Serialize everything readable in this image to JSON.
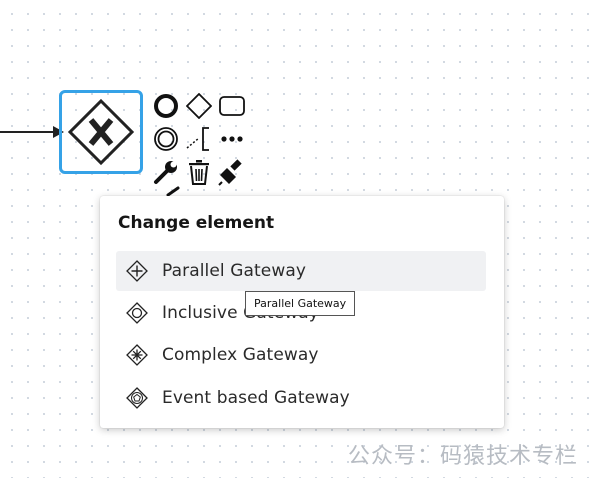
{
  "canvas": {
    "selected_element": "exclusive-gateway",
    "context_pad": {
      "tools": [
        {
          "name": "append-end-event-icon"
        },
        {
          "name": "append-gateway-icon"
        },
        {
          "name": "append-task-icon"
        },
        {
          "name": "append-intermediate-event-icon"
        },
        {
          "name": "append-text-annotation-icon"
        },
        {
          "name": "more-options-icon"
        },
        {
          "name": "change-type-wrench-icon"
        },
        {
          "name": "delete-trash-icon"
        },
        {
          "name": "color-paint-icon"
        }
      ]
    }
  },
  "popup": {
    "title": "Change element",
    "entries": [
      {
        "label": "Parallel Gateway",
        "icon": "parallel-gateway-icon",
        "hovered": true
      },
      {
        "label": "Inclusive Gateway",
        "icon": "inclusive-gateway-icon",
        "hovered": false
      },
      {
        "label": "Complex Gateway",
        "icon": "complex-gateway-icon",
        "hovered": false
      },
      {
        "label": "Event based Gateway",
        "icon": "event-based-gateway-icon",
        "hovered": false
      }
    ]
  },
  "tooltip": {
    "text": "Parallel Gateway"
  },
  "watermark": {
    "text": "公众号：码猿技术专栏"
  },
  "colors": {
    "selection": "#35a2e7",
    "hover_bg": "#f0f1f3",
    "text": "#2a2a2a"
  }
}
